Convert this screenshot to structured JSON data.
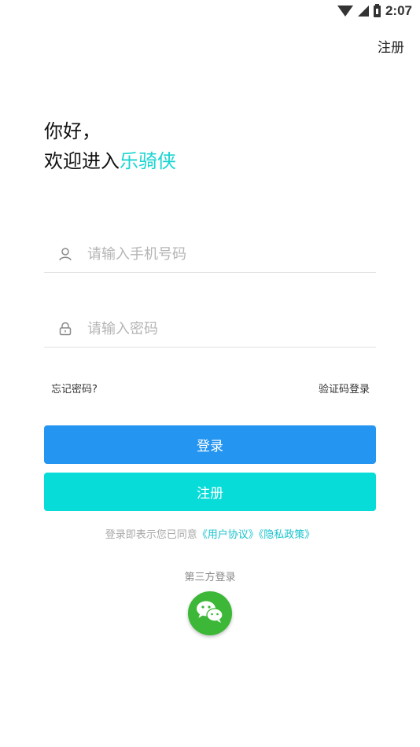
{
  "status_bar": {
    "time": "2:07"
  },
  "header": {
    "register_link": "注册"
  },
  "greeting": {
    "line1": "你好，",
    "line2_prefix": "欢迎进入",
    "brand_name": "乐骑侠"
  },
  "form": {
    "phone_placeholder": "请输入手机号码",
    "password_placeholder": "请输入密码",
    "forgot_password": "忘记密码?",
    "sms_login": "验证码登录"
  },
  "buttons": {
    "login": "登录",
    "register": "注册"
  },
  "agreement": {
    "prefix": "登录即表示您已同意",
    "user_agreement": "《用户协议》",
    "privacy_policy": "《隐私政策》"
  },
  "third_party": {
    "label": "第三方登录",
    "wechat_icon": "wechat-icon"
  },
  "colors": {
    "brand": "#19d6d1",
    "login_button": "#2495f0",
    "register_button": "#07dcd9",
    "wechat": "#3cb737"
  }
}
